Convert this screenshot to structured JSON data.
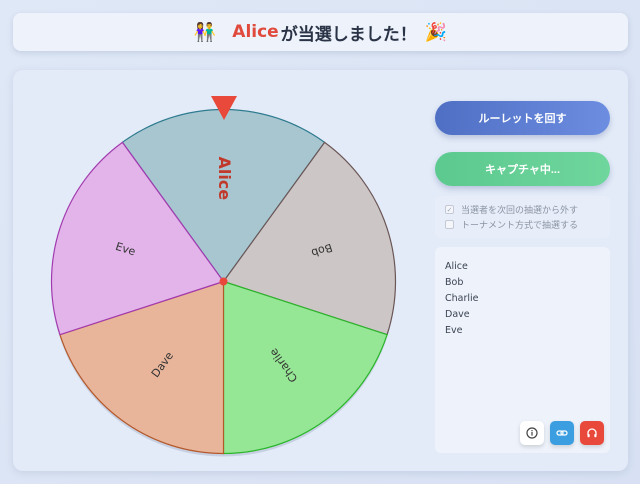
{
  "banner": {
    "winner": "Alice",
    "message": "が当選しました！",
    "left_icon": "couple-emoji",
    "right_icon": "party-popper-emoji"
  },
  "wheel": {
    "segments": [
      {
        "label": "Alice",
        "color": "#a8c6d0",
        "stroke": "#2e7b8f",
        "share": 0.2,
        "highlight": true
      },
      {
        "label": "Bob",
        "color": "#cdc6c6",
        "stroke": "#6b5656",
        "share": 0.2,
        "highlight": false
      },
      {
        "label": "Charlie",
        "color": "#95e795",
        "stroke": "#2bb52b",
        "share": 0.2,
        "highlight": false
      },
      {
        "label": "Dave",
        "color": "#e8b59a",
        "stroke": "#b4582c",
        "share": 0.2,
        "highlight": false
      },
      {
        "label": "Eve",
        "color": "#e3b4ea",
        "stroke": "#a23aaf",
        "share": 0.2,
        "highlight": false
      }
    ],
    "winner_color": "#c0392b",
    "label_color": "#333333"
  },
  "controls": {
    "spin_label": "ルーレットを回す",
    "capture_label": "キャプチャ中..."
  },
  "options": {
    "exclude_winner": {
      "label": "当選者を次回の抽選から外す",
      "checked": true
    },
    "tournament": {
      "label": "トーナメント方式で抽選する",
      "checked": false
    }
  },
  "names": [
    "Alice",
    "Bob",
    "Charlie",
    "Dave",
    "Eve"
  ],
  "icons": {
    "info": "info-icon",
    "link": "link-icon",
    "reset": "headphones-reset-icon"
  }
}
